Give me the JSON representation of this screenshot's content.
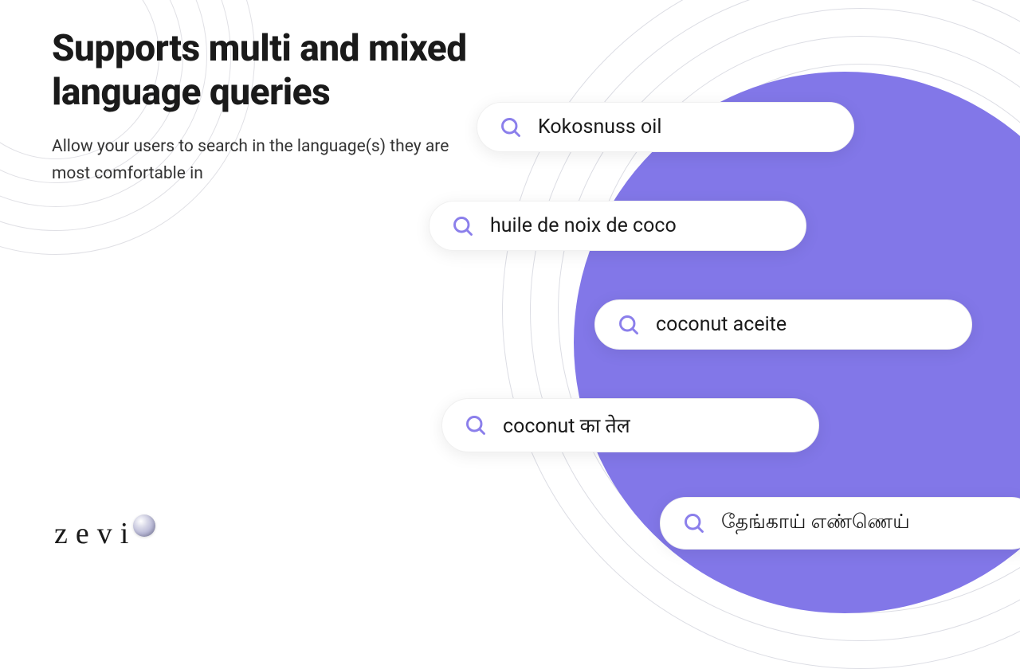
{
  "heading": "Supports multi and mixed language queries",
  "subheading": "Allow your users to search in the language(s) they are most comfortable in",
  "search_examples": {
    "example1": "Kokosnuss oil",
    "example2": "huile de noix de coco",
    "example3": "coconut aceite",
    "example4": "coconut का तेल",
    "example5": "தேங்காய் எண்ணெய்"
  },
  "brand": {
    "name": "zevi"
  },
  "colors": {
    "accent": "#8277e8",
    "icon": "#8b7feb"
  }
}
